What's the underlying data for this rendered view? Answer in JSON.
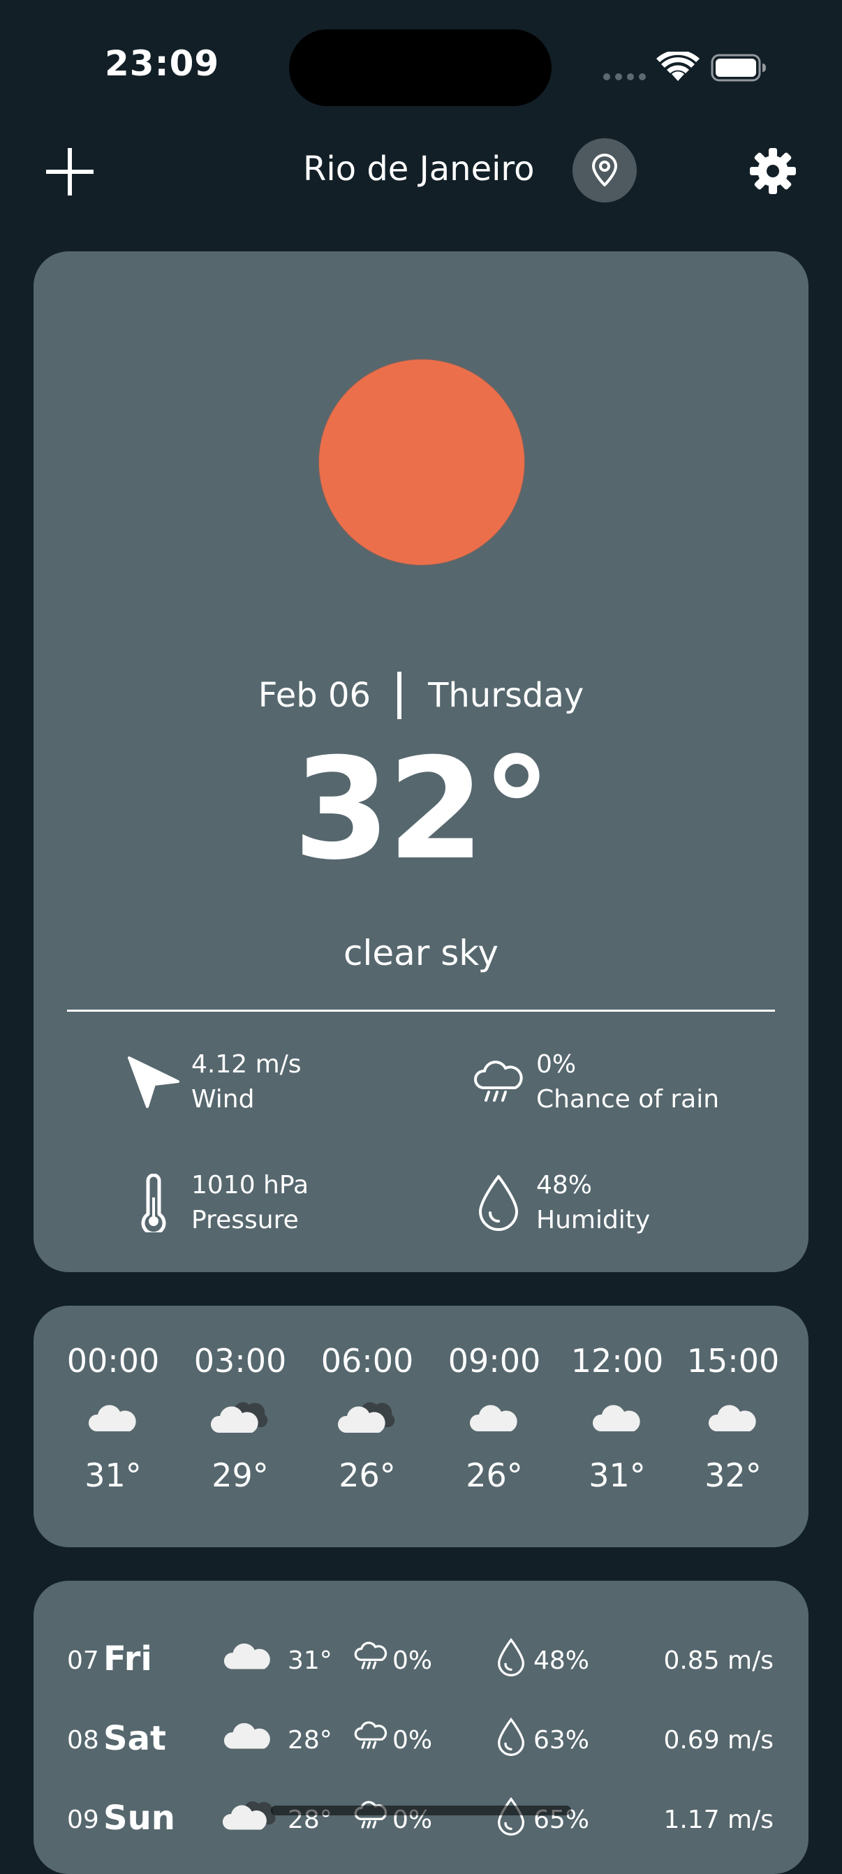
{
  "status_bar": {
    "time": "23:09"
  },
  "header": {
    "city": "Rio de Janeiro"
  },
  "current": {
    "date": "Feb 06",
    "weekday": "Thursday",
    "temperature": "32°",
    "condition": "clear sky",
    "wind_value": "4.12 m/s",
    "wind_label": "Wind",
    "rain_value": "0%",
    "rain_label": "Chance of rain",
    "pressure_value": "1010 hPa",
    "pressure_label": "Pressure",
    "humidity_value": "48%",
    "humidity_label": "Humidity",
    "sun_color": "#ec6f4b"
  },
  "hourly": [
    {
      "time": "00:00",
      "temp": "31°",
      "icon": "cloud-icon"
    },
    {
      "time": "03:00",
      "temp": "29°",
      "icon": "cloud-night-icon"
    },
    {
      "time": "06:00",
      "temp": "26°",
      "icon": "cloud-night-icon"
    },
    {
      "time": "09:00",
      "temp": "26°",
      "icon": "cloud-icon"
    },
    {
      "time": "12:00",
      "temp": "31°",
      "icon": "cloud-icon"
    },
    {
      "time": "15:00",
      "temp": "32°",
      "icon": "cloud-icon"
    }
  ],
  "daily": [
    {
      "num": "07",
      "day": "Fri",
      "temp": "31°",
      "rain": "0%",
      "humidity": "48%",
      "wind": "0.85 m/s",
      "icon": "cloud-icon"
    },
    {
      "num": "08",
      "day": "Sat",
      "temp": "28°",
      "rain": "0%",
      "humidity": "63%",
      "wind": "0.69 m/s",
      "icon": "cloud-icon"
    },
    {
      "num": "09",
      "day": "Sun",
      "temp": "28°",
      "rain": "0%",
      "humidity": "65%",
      "wind": "1.17 m/s",
      "icon": "cloud-night-icon"
    }
  ]
}
